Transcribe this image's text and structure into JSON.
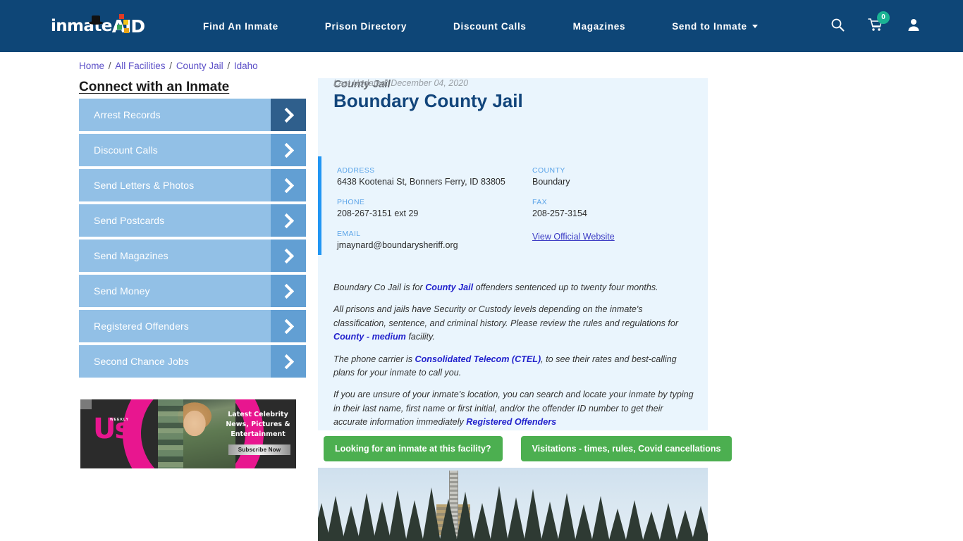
{
  "header": {
    "logo": {
      "text1": "inmate",
      "text2": "AID",
      "icon": "logo-icon"
    },
    "nav": [
      {
        "label": "Find An Inmate",
        "dropdown": false
      },
      {
        "label": "Prison Directory",
        "dropdown": false
      },
      {
        "label": "Discount Calls",
        "dropdown": false
      },
      {
        "label": "Magazines",
        "dropdown": false
      },
      {
        "label": "Send to Inmate",
        "dropdown": true
      }
    ],
    "icons": {
      "search": "search-icon",
      "cart": "shopping-cart-icon",
      "cart_count": "0",
      "account": "user-account-icon"
    },
    "bg_color": "#0e4677",
    "badge_color": "#1bb394"
  },
  "breadcrumb": {
    "items": [
      "Home",
      "All Facilities",
      "County Jail",
      "Idaho"
    ],
    "separator": "/",
    "link_color": "#5b4fc7"
  },
  "sidebar": {
    "title": "Connect with an Inmate",
    "items": [
      {
        "label": "Arrest Records",
        "active": true
      },
      {
        "label": "Discount Calls",
        "active": false
      },
      {
        "label": "Send Letters & Photos",
        "active": false
      },
      {
        "label": "Send Postcards",
        "active": false
      },
      {
        "label": "Send Magazines",
        "active": false
      },
      {
        "label": "Send Money",
        "active": false
      },
      {
        "label": "Registered Offenders",
        "active": false
      },
      {
        "label": "Second Chance Jobs",
        "active": false
      }
    ],
    "button_color": "#92c0e6",
    "arrow_color": "#629fd3",
    "arrow_active_color": "#2f5f8c"
  },
  "ad": {
    "brand": "Us",
    "brand_sub": "WEEKLY",
    "headline": "Latest Celebrity News, Pictures & Entertainment",
    "cta": "Subscribe Now",
    "accent_color": "#e8168f"
  },
  "facility": {
    "name": "Boundary County Jail",
    "type": "County Jail",
    "last_updated": "Last Updated: December 04, 2020",
    "info": [
      {
        "label": "ADDRESS",
        "value": "6438 Kootenai St, Bonners Ferry, ID 83805",
        "link": false
      },
      {
        "label": "COUNTY",
        "value": "Boundary",
        "link": false
      },
      {
        "label": "PHONE",
        "value": "208-267-3151 ext 29",
        "link": false
      },
      {
        "label": "FAX",
        "value": "208-257-3154",
        "link": false
      },
      {
        "label": "EMAIL",
        "value": "jmaynard@boundarysheriff.org",
        "link": false
      },
      {
        "label": "",
        "value": "View Official Website",
        "link": true
      }
    ],
    "accent_color": "#2196f3",
    "card_bg": "#eaf5fd",
    "title_color": "#12457b"
  },
  "description": {
    "p1_before": "Boundary Co Jail is for ",
    "p1_link": "County Jail",
    "p1_after": " offenders sentenced up to twenty four months.",
    "p2_before": "All prisons and jails have Security or Custody levels depending on the inmate's classification, sentence, and criminal history. Please review the rules and regulations for ",
    "p2_link": "County - medium",
    "p2_after": " facility.",
    "p3_before": "The phone carrier is ",
    "p3_link": "Consolidated Telecom (CTEL)",
    "p3_after": ", to see their rates and best-calling plans for your inmate to call you.",
    "p4_before": "If you are unsure of your inmate's location, you can search and locate your inmate by typing in their last name, first name or first initial, and/or the offender ID number to get their accurate information immediately ",
    "p4_link": "Registered Offenders",
    "p4_after": "",
    "link_color": "#2222cc"
  },
  "actions": {
    "buttons": [
      {
        "label": "Looking for an inmate at this facility?"
      },
      {
        "label": "Visitations - times, rules, Covid cancellations"
      }
    ],
    "color": "#4caf50"
  },
  "photo": {
    "alt": "facility-photo-pine-trees-tower"
  }
}
